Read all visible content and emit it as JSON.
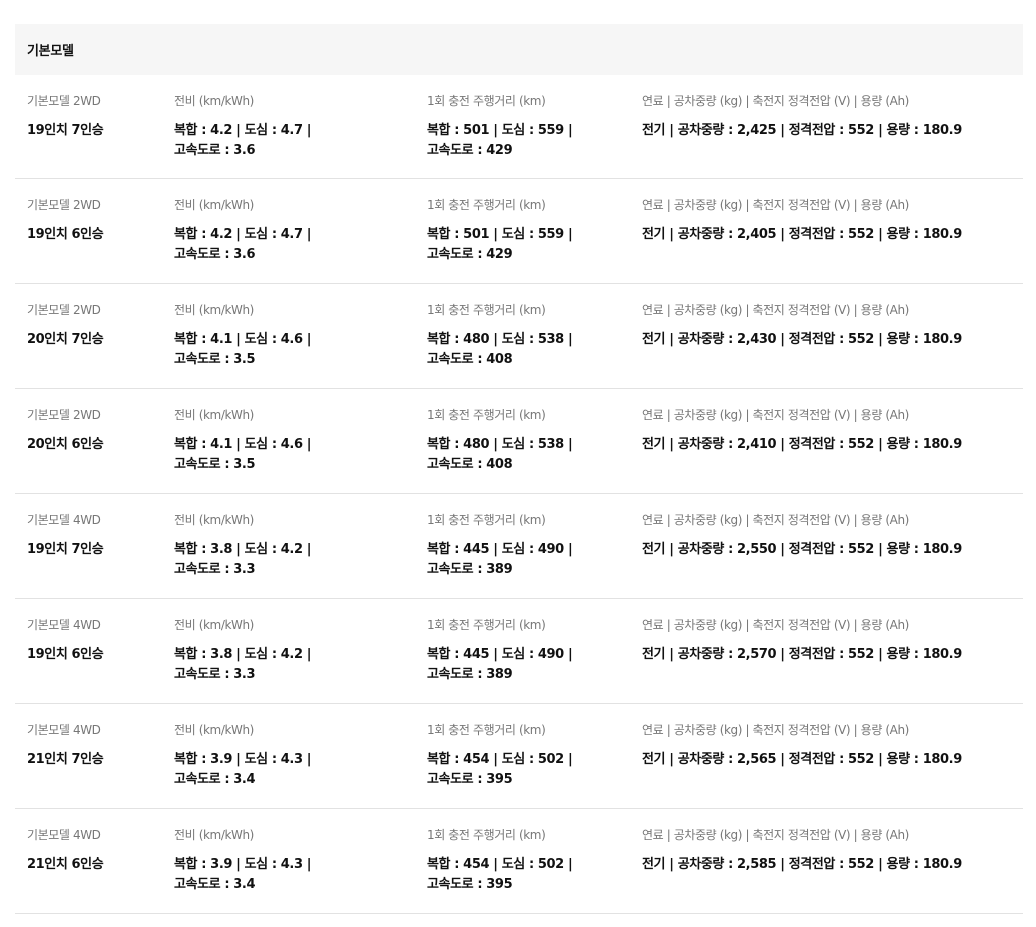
{
  "section": {
    "title": "기본모델"
  },
  "labels": {
    "efficiency": "전비 (km/kWh)",
    "range": "1회 충전 주행거리 (km)",
    "specs": "연료 | 공차중량 (kg) | 축전지 정격전압 (V) | 용량 (Ah)"
  },
  "rows": [
    {
      "model": "기본모델 2WD",
      "trim": "19인치 7인승",
      "efficiency": [
        "복합 : 4.2 | 도심 : 4.7 |",
        "고속도로 : 3.6"
      ],
      "range": [
        "복합 : 501 | 도심 : 559 |",
        "고속도로 : 429"
      ],
      "specs": "전기 | 공차중량 : 2,425 | 정격전압 : 552 | 용량 : 180.9"
    },
    {
      "model": "기본모델 2WD",
      "trim": "19인치 6인승",
      "efficiency": [
        "복합 : 4.2 | 도심 : 4.7 |",
        "고속도로 : 3.6"
      ],
      "range": [
        "복합 : 501 | 도심 : 559 |",
        "고속도로 : 429"
      ],
      "specs": "전기 | 공차중량 : 2,405 | 정격전압 : 552 | 용량 : 180.9"
    },
    {
      "model": "기본모델 2WD",
      "trim": "20인치 7인승",
      "efficiency": [
        "복합 : 4.1 | 도심 : 4.6 |",
        "고속도로 : 3.5"
      ],
      "range": [
        "복합 : 480 | 도심 : 538 |",
        "고속도로 : 408"
      ],
      "specs": "전기 | 공차중량 : 2,430 | 정격전압 : 552 | 용량 : 180.9"
    },
    {
      "model": "기본모델 2WD",
      "trim": "20인치 6인승",
      "efficiency": [
        "복합 : 4.1 | 도심 : 4.6 |",
        "고속도로 : 3.5"
      ],
      "range": [
        "복합 : 480 | 도심 : 538 |",
        "고속도로 : 408"
      ],
      "specs": "전기 | 공차중량 : 2,410 | 정격전압 : 552 | 용량 : 180.9"
    },
    {
      "model": "기본모델 4WD",
      "trim": "19인치 7인승",
      "efficiency": [
        "복합 : 3.8 | 도심 : 4.2 |",
        "고속도로 : 3.3"
      ],
      "range": [
        "복합 : 445 | 도심 : 490 |",
        "고속도로 : 389"
      ],
      "specs": "전기 | 공차중량 : 2,550 | 정격전압 : 552 | 용량 : 180.9"
    },
    {
      "model": "기본모델 4WD",
      "trim": "19인치 6인승",
      "efficiency": [
        "복합 : 3.8 | 도심 : 4.2 |",
        "고속도로 : 3.3"
      ],
      "range": [
        "복합 : 445 | 도심 : 490 |",
        "고속도로 : 389"
      ],
      "specs": "전기 | 공차중량 : 2,570 | 정격전압 : 552 | 용량 : 180.9"
    },
    {
      "model": "기본모델 4WD",
      "trim": "21인치 7인승",
      "efficiency": [
        "복합 : 3.9 | 도심 : 4.3 |",
        "고속도로 : 3.4"
      ],
      "range": [
        "복합 : 454 | 도심 : 502 |",
        "고속도로 : 395"
      ],
      "specs": "전기 | 공차중량 : 2,565 | 정격전압 : 552 | 용량 : 180.9"
    },
    {
      "model": "기본모델 4WD",
      "trim": "21인치 6인승",
      "efficiency": [
        "복합 : 3.9 | 도심 : 4.3 |",
        "고속도로 : 3.4"
      ],
      "range": [
        "복합 : 454 | 도심 : 502 |",
        "고속도로 : 395"
      ],
      "specs": "전기 | 공차중량 : 2,585 | 정격전압 : 552 | 용량 : 180.9"
    }
  ]
}
